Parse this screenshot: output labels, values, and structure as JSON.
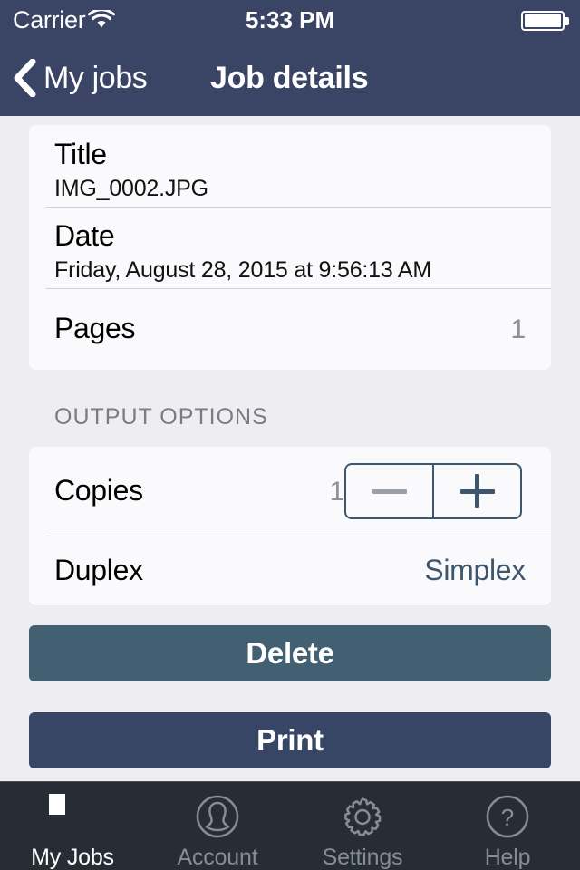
{
  "status_bar": {
    "carrier": "Carrier",
    "wifi_icon": "wifi-icon",
    "time": "5:33 PM",
    "battery_icon": "battery-full-icon"
  },
  "nav_bar": {
    "back_icon": "chevron-left-icon",
    "back_label": "My jobs",
    "title": "Job details"
  },
  "job_info": {
    "title_label": "Title",
    "title_value": "IMG_0002.JPG",
    "date_label": "Date",
    "date_value": "Friday, August 28, 2015 at 9:56:13 AM",
    "pages_label": "Pages",
    "pages_value": "1"
  },
  "output_options": {
    "section_header": "OUTPUT OPTIONS",
    "copies_label": "Copies",
    "copies_value": "1",
    "stepper_minus": "−",
    "stepper_plus": "+",
    "duplex_label": "Duplex",
    "duplex_value": "Simplex"
  },
  "actions": {
    "delete_label": "Delete",
    "print_label": "Print"
  },
  "tab_bar": {
    "tabs": [
      {
        "label": "My Jobs",
        "icon": "list-lines-icon",
        "active": true
      },
      {
        "label": "Account",
        "icon": "person-circle-icon",
        "active": false
      },
      {
        "label": "Settings",
        "icon": "gear-icon",
        "active": false
      },
      {
        "label": "Help",
        "icon": "question-circle-icon",
        "active": false
      }
    ]
  },
  "colors": {
    "nav_navy": "#3a4565",
    "page_background": "#eeeef2",
    "card_background": "#fafafc",
    "accent_slate": "#3d566e",
    "delete_button": "#436073",
    "print_button": "#384665",
    "tabbar_background": "#272d35",
    "tab_active": "#ffffff",
    "tab_inactive": "#868d96",
    "muted_text": "#8e8e93"
  }
}
